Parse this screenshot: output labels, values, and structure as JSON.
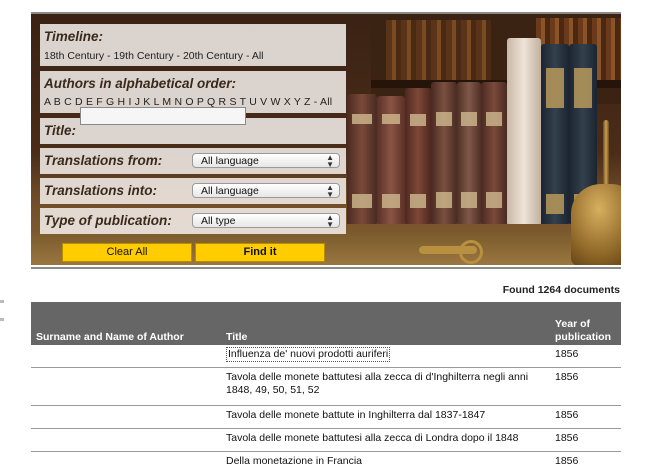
{
  "form": {
    "timeline": {
      "label": "Timeline:",
      "options": [
        "18th Century",
        "19th Century",
        "20th Century",
        "All"
      ]
    },
    "authors": {
      "label": "Authors in alphabetical order:",
      "letters": [
        "A",
        "B",
        "C",
        "D",
        "E",
        "F",
        "G",
        "H",
        "I",
        "J",
        "K",
        "L",
        "M",
        "N",
        "O",
        "P",
        "Q",
        "R",
        "S",
        "T",
        "U",
        "V",
        "W",
        "X",
        "Y",
        "Z"
      ],
      "all_label": "All"
    },
    "title_label": "Title:",
    "title_value": "",
    "translations_from": {
      "label": "Translations from:",
      "value": "All language"
    },
    "translations_into": {
      "label": "Translations into:",
      "value": "All language"
    },
    "publication_type": {
      "label": "Type of publication:",
      "value": "All type"
    },
    "clear_label": "Clear All",
    "find_label": "Find it"
  },
  "results": {
    "found_text": "Found 1264 documents",
    "headers": {
      "author": "Surname and Name of Author",
      "title": "Title",
      "year_line1": "Year of",
      "year_line2": "publication"
    },
    "rows": [
      {
        "author": "",
        "title": "Influenza de' nuovi prodotti auriferi",
        "year": "1856"
      },
      {
        "author": "",
        "title_line1": "Tavola delle monete battutesi alla zecca di d'Inghilterra negli anni",
        "title_line2": "1848, 49, 50, 51, 52",
        "year": "1856"
      },
      {
        "author": "",
        "title": "Tavola delle monete battute in Inghilterra dal 1837-1847",
        "year": "1856"
      },
      {
        "author": "",
        "title": "Tavola delle monete battutesi alla zecca di Londra dopo il 1848",
        "year": "1856"
      },
      {
        "author": "",
        "title": "Della monetazione in Francia",
        "year": "1856"
      }
    ]
  },
  "colors": {
    "button_yellow": "#ffcc00",
    "table_header": "#666666",
    "panel_bg": "#f4f0ec"
  }
}
